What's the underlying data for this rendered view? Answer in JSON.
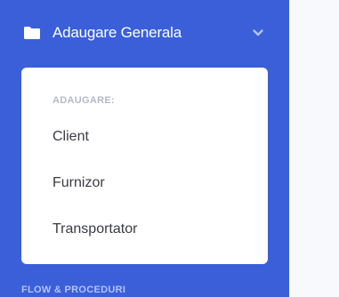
{
  "sidebar": {
    "nav_item": {
      "label": "Adaugare Generala",
      "icon": "folder-icon",
      "chevron_icon": "chevron-down-icon"
    },
    "collapse": {
      "header": "ADAUGARE:",
      "items": [
        {
          "label": "Client"
        },
        {
          "label": "Furnizor"
        },
        {
          "label": "Transportator"
        }
      ]
    },
    "section_heading": "FLOW & PROCEDURI"
  },
  "colors": {
    "sidebar_bg": "#3a5fd9",
    "panel_bg": "#ffffff",
    "page_bg": "#f8f9fc",
    "item_text": "#3a3b45",
    "collapse_header_text": "#b7b9cc"
  }
}
